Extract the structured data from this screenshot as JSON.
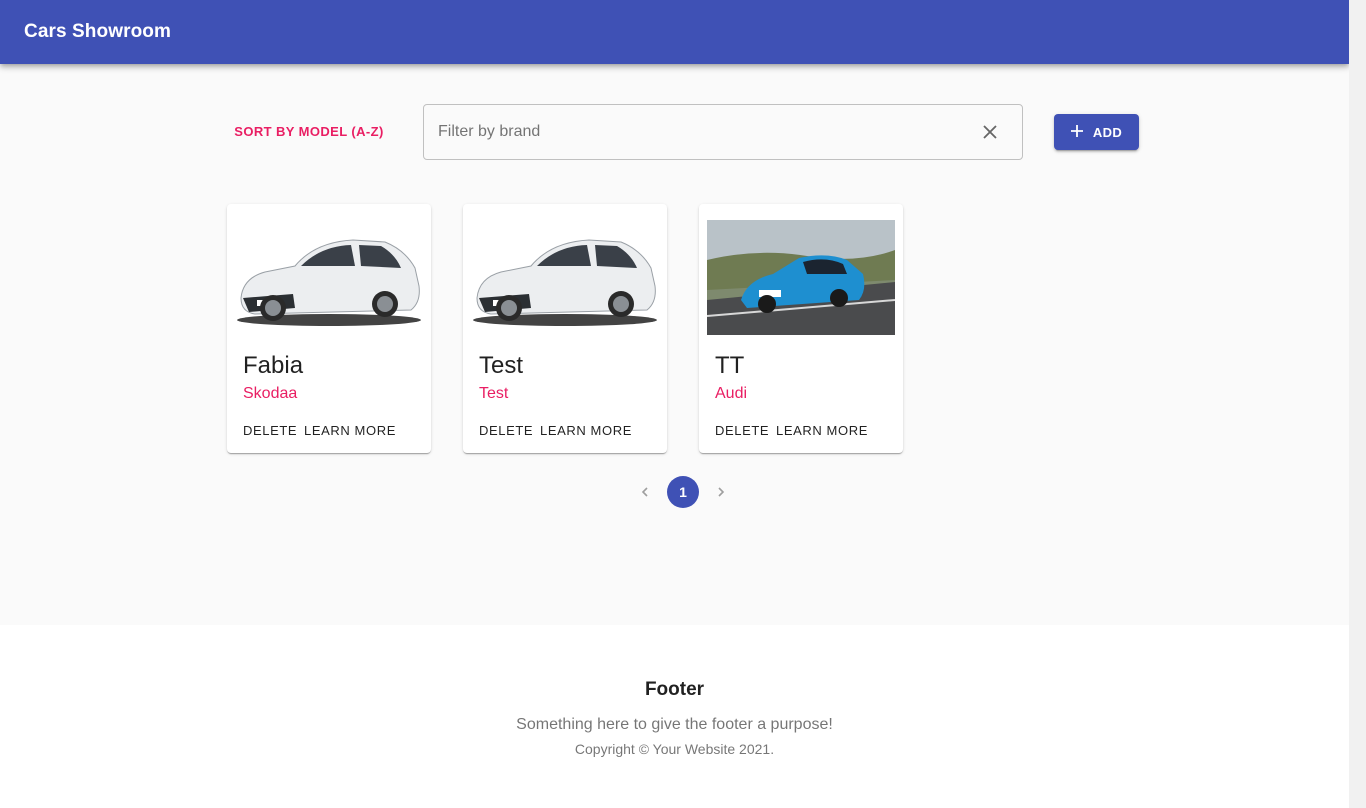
{
  "appbar": {
    "title": "Cars Showroom"
  },
  "toolbar": {
    "sort_label": "SORT BY MODEL (A-Z)",
    "filter_placeholder": "Filter by brand",
    "filter_value": "",
    "add_label": "ADD"
  },
  "cars": [
    {
      "model": "Fabia",
      "brand": "Skodaa",
      "delete_label": "DELETE",
      "learn_label": "LEARN MORE",
      "image": "white-hatchback"
    },
    {
      "model": "Test",
      "brand": "Test",
      "delete_label": "DELETE",
      "learn_label": "LEARN MORE",
      "image": "white-hatchback"
    },
    {
      "model": "TT",
      "brand": "Audi",
      "delete_label": "DELETE",
      "learn_label": "LEARN MORE",
      "image": "blue-coupe-on-road"
    }
  ],
  "pagination": {
    "current": "1"
  },
  "footer": {
    "title": "Footer",
    "text": "Something here to give the footer a purpose!",
    "copyright": "Copyright © Your Website 2021."
  },
  "colors": {
    "primary": "#3f51b5",
    "secondary": "#e91e63"
  }
}
